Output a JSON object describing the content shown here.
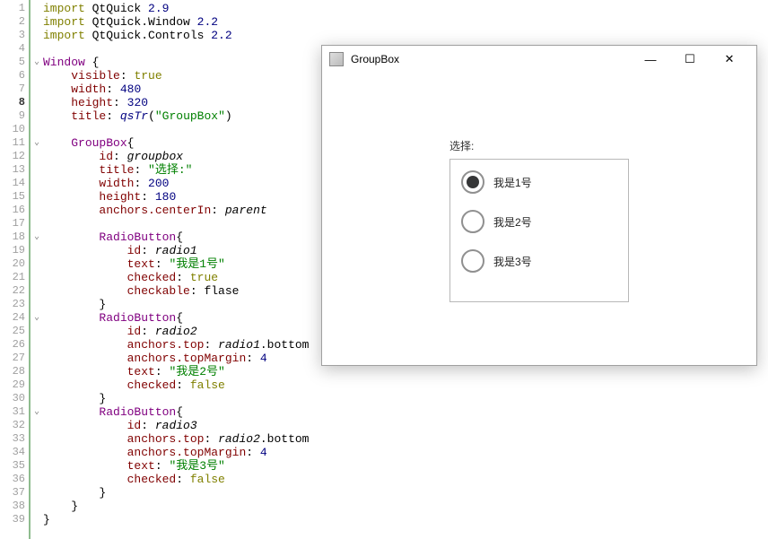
{
  "editor": {
    "lines": [
      {
        "n": 1,
        "fold": "",
        "segs": [
          [
            "kw-import",
            "import"
          ],
          [
            "plain",
            " QtQuick "
          ],
          [
            "num",
            "2.9"
          ]
        ]
      },
      {
        "n": 2,
        "fold": "",
        "segs": [
          [
            "kw-import",
            "import"
          ],
          [
            "plain",
            " QtQuick.Window "
          ],
          [
            "num",
            "2.2"
          ]
        ]
      },
      {
        "n": 3,
        "fold": "",
        "segs": [
          [
            "kw-import",
            "import"
          ],
          [
            "plain",
            " QtQuick.Controls "
          ],
          [
            "num",
            "2.2"
          ]
        ]
      },
      {
        "n": 4,
        "fold": "",
        "segs": [
          [
            "plain",
            ""
          ]
        ]
      },
      {
        "n": 5,
        "fold": "v",
        "segs": [
          [
            "kw-type",
            "Window"
          ],
          [
            "plain",
            " {"
          ]
        ]
      },
      {
        "n": 6,
        "fold": "",
        "segs": [
          [
            "plain",
            "    "
          ],
          [
            "prop",
            "visible"
          ],
          [
            "plain",
            ": "
          ],
          [
            "bool",
            "true"
          ]
        ]
      },
      {
        "n": 7,
        "fold": "",
        "segs": [
          [
            "plain",
            "    "
          ],
          [
            "prop",
            "width"
          ],
          [
            "plain",
            ": "
          ],
          [
            "num",
            "480"
          ]
        ]
      },
      {
        "n": 8,
        "fold": "",
        "current": true,
        "segs": [
          [
            "plain",
            "    "
          ],
          [
            "prop",
            "height"
          ],
          [
            "plain",
            ": "
          ],
          [
            "num",
            "320"
          ]
        ]
      },
      {
        "n": 9,
        "fold": "",
        "segs": [
          [
            "plain",
            "    "
          ],
          [
            "prop",
            "title"
          ],
          [
            "plain",
            ": "
          ],
          [
            "fn",
            "qsTr"
          ],
          [
            "plain",
            "("
          ],
          [
            "str",
            "\"GroupBox\""
          ],
          [
            "plain",
            ")"
          ]
        ]
      },
      {
        "n": 10,
        "fold": "",
        "segs": [
          [
            "plain",
            ""
          ]
        ]
      },
      {
        "n": 11,
        "fold": "v",
        "segs": [
          [
            "plain",
            "    "
          ],
          [
            "kw-type",
            "GroupBox"
          ],
          [
            "plain",
            "{"
          ]
        ]
      },
      {
        "n": 12,
        "fold": "",
        "segs": [
          [
            "plain",
            "        "
          ],
          [
            "prop",
            "id"
          ],
          [
            "plain",
            ": "
          ],
          [
            "id",
            "groupbox"
          ]
        ]
      },
      {
        "n": 13,
        "fold": "",
        "segs": [
          [
            "plain",
            "        "
          ],
          [
            "prop",
            "title"
          ],
          [
            "plain",
            ": "
          ],
          [
            "str",
            "\"选择:\""
          ]
        ]
      },
      {
        "n": 14,
        "fold": "",
        "segs": [
          [
            "plain",
            "        "
          ],
          [
            "prop",
            "width"
          ],
          [
            "plain",
            ": "
          ],
          [
            "num",
            "200"
          ]
        ]
      },
      {
        "n": 15,
        "fold": "",
        "segs": [
          [
            "plain",
            "        "
          ],
          [
            "prop",
            "height"
          ],
          [
            "plain",
            ": "
          ],
          [
            "num",
            "180"
          ]
        ]
      },
      {
        "n": 16,
        "fold": "",
        "segs": [
          [
            "plain",
            "        "
          ],
          [
            "prop",
            "anchors.centerIn"
          ],
          [
            "plain",
            ": "
          ],
          [
            "ref",
            "parent"
          ]
        ]
      },
      {
        "n": 17,
        "fold": "",
        "segs": [
          [
            "plain",
            ""
          ]
        ]
      },
      {
        "n": 18,
        "fold": "v",
        "segs": [
          [
            "plain",
            "        "
          ],
          [
            "kw-type",
            "RadioButton"
          ],
          [
            "plain",
            "{"
          ]
        ]
      },
      {
        "n": 19,
        "fold": "",
        "segs": [
          [
            "plain",
            "            "
          ],
          [
            "prop",
            "id"
          ],
          [
            "plain",
            ": "
          ],
          [
            "id",
            "radio1"
          ]
        ]
      },
      {
        "n": 20,
        "fold": "",
        "segs": [
          [
            "plain",
            "            "
          ],
          [
            "prop",
            "text"
          ],
          [
            "plain",
            ": "
          ],
          [
            "str",
            "\"我是1号\""
          ]
        ]
      },
      {
        "n": 21,
        "fold": "",
        "segs": [
          [
            "plain",
            "            "
          ],
          [
            "prop",
            "checked"
          ],
          [
            "plain",
            ": "
          ],
          [
            "bool",
            "true"
          ]
        ]
      },
      {
        "n": 22,
        "fold": "",
        "segs": [
          [
            "plain",
            "            "
          ],
          [
            "prop",
            "checkable"
          ],
          [
            "plain",
            ": "
          ],
          [
            "plain",
            "flase"
          ]
        ]
      },
      {
        "n": 23,
        "fold": "",
        "segs": [
          [
            "plain",
            "        }"
          ]
        ]
      },
      {
        "n": 24,
        "fold": "v",
        "segs": [
          [
            "plain",
            "        "
          ],
          [
            "kw-type",
            "RadioButton"
          ],
          [
            "plain",
            "{"
          ]
        ]
      },
      {
        "n": 25,
        "fold": "",
        "segs": [
          [
            "plain",
            "            "
          ],
          [
            "prop",
            "id"
          ],
          [
            "plain",
            ": "
          ],
          [
            "id",
            "radio2"
          ]
        ]
      },
      {
        "n": 26,
        "fold": "",
        "segs": [
          [
            "plain",
            "            "
          ],
          [
            "prop",
            "anchors.top"
          ],
          [
            "plain",
            ": "
          ],
          [
            "ref",
            "radio1"
          ],
          [
            "plain",
            ".bottom"
          ]
        ]
      },
      {
        "n": 27,
        "fold": "",
        "segs": [
          [
            "plain",
            "            "
          ],
          [
            "prop",
            "anchors.topMargin"
          ],
          [
            "plain",
            ": "
          ],
          [
            "num",
            "4"
          ]
        ]
      },
      {
        "n": 28,
        "fold": "",
        "segs": [
          [
            "plain",
            "            "
          ],
          [
            "prop",
            "text"
          ],
          [
            "plain",
            ": "
          ],
          [
            "str",
            "\"我是2号\""
          ]
        ]
      },
      {
        "n": 29,
        "fold": "",
        "segs": [
          [
            "plain",
            "            "
          ],
          [
            "prop",
            "checked"
          ],
          [
            "plain",
            ": "
          ],
          [
            "bool",
            "false"
          ]
        ]
      },
      {
        "n": 30,
        "fold": "",
        "segs": [
          [
            "plain",
            "        }"
          ]
        ]
      },
      {
        "n": 31,
        "fold": "v",
        "segs": [
          [
            "plain",
            "        "
          ],
          [
            "kw-type",
            "RadioButton"
          ],
          [
            "plain",
            "{"
          ]
        ]
      },
      {
        "n": 32,
        "fold": "",
        "segs": [
          [
            "plain",
            "            "
          ],
          [
            "prop",
            "id"
          ],
          [
            "plain",
            ": "
          ],
          [
            "id",
            "radio3"
          ]
        ]
      },
      {
        "n": 33,
        "fold": "",
        "segs": [
          [
            "plain",
            "            "
          ],
          [
            "prop",
            "anchors.top"
          ],
          [
            "plain",
            ": "
          ],
          [
            "ref",
            "radio2"
          ],
          [
            "plain",
            ".bottom"
          ]
        ]
      },
      {
        "n": 34,
        "fold": "",
        "segs": [
          [
            "plain",
            "            "
          ],
          [
            "prop",
            "anchors.topMargin"
          ],
          [
            "plain",
            ": "
          ],
          [
            "num",
            "4"
          ]
        ]
      },
      {
        "n": 35,
        "fold": "",
        "segs": [
          [
            "plain",
            "            "
          ],
          [
            "prop",
            "text"
          ],
          [
            "plain",
            ": "
          ],
          [
            "str",
            "\"我是3号\""
          ]
        ]
      },
      {
        "n": 36,
        "fold": "",
        "segs": [
          [
            "plain",
            "            "
          ],
          [
            "prop",
            "checked"
          ],
          [
            "plain",
            ": "
          ],
          [
            "bool",
            "false"
          ]
        ]
      },
      {
        "n": 37,
        "fold": "",
        "segs": [
          [
            "plain",
            "        }"
          ]
        ]
      },
      {
        "n": 38,
        "fold": "",
        "segs": [
          [
            "plain",
            "    }"
          ]
        ]
      },
      {
        "n": 39,
        "fold": "",
        "segs": [
          [
            "plain",
            "}"
          ]
        ]
      }
    ]
  },
  "window": {
    "title": "GroupBox",
    "buttons": {
      "min": "—",
      "max": "☐",
      "close": "✕"
    },
    "groupbox": {
      "title": "选择:",
      "radios": [
        {
          "label": "我是1号",
          "checked": true
        },
        {
          "label": "我是2号",
          "checked": false
        },
        {
          "label": "我是3号",
          "checked": false
        }
      ]
    }
  }
}
